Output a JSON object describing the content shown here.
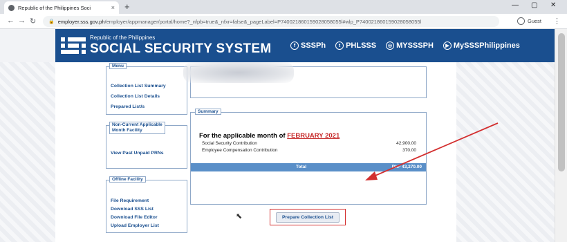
{
  "browser": {
    "tab_title": "Republic of the Philippines Soci",
    "tab_close": "×",
    "new_tab": "+",
    "window_controls": [
      "—",
      "▢",
      "✕"
    ],
    "nav": [
      "←",
      "→",
      "↻"
    ],
    "url_host": "employer.sss.gov.ph",
    "url_path": "/employer/appmanager/portal/home?_nfpb=true&_nfxr=false&_pageLabel=P740021860159028058055l#wlp_P740021860159028058055l",
    "profile": "Guest"
  },
  "banner": {
    "subtitle": "Republic of the Philippines",
    "title": "SOCIAL SECURITY SYSTEM",
    "socials": [
      "SSSPh",
      "PHLSSS",
      "MYSSSPH",
      "MySSSPhilippines"
    ]
  },
  "menu": {
    "legend": "Menu",
    "items": [
      "Collection List Summary",
      "Collection List Details",
      "Prepared List/s"
    ]
  },
  "non_current": {
    "legend_line1": "Non-Current Applicable",
    "legend_line2": "Month Facility",
    "items": [
      "View Past Unpaid PRNs"
    ]
  },
  "offline": {
    "legend": "Offline Facility",
    "items": [
      "File Requirement",
      "Download SSS List",
      "Download File Editor",
      "Upload Employer List"
    ]
  },
  "summary": {
    "legend": "Summary",
    "month_prefix": "For the applicable month of ",
    "month": "FEBRUARY 2021",
    "rows": [
      {
        "label": "Social Security Contribution",
        "amount": "42,900.00"
      },
      {
        "label": "Employee Compensation Contribution",
        "amount": "370.00"
      }
    ],
    "total_label": "Total",
    "total_amount": "PhP 43,270.00"
  },
  "actions": {
    "prepare_label": "Prepare Collection List"
  },
  "colors": {
    "brand": "#1a4f8f",
    "highlight": "#c62828",
    "annotation": "#d32f2f"
  }
}
